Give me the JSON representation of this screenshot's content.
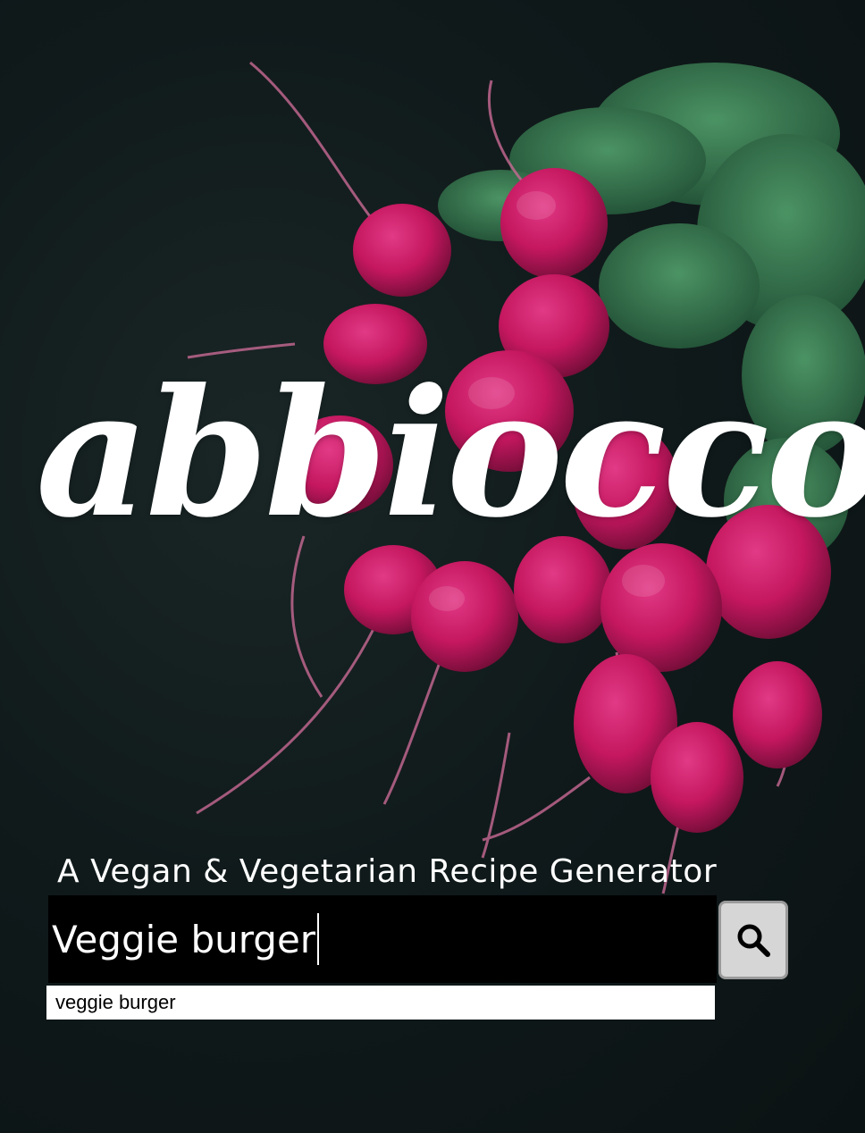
{
  "hero": {
    "logo_text": "abbiocco",
    "tagline": "A Vegan & Vegetarian Recipe Generator"
  },
  "search": {
    "value": "Veggie burger",
    "button_icon": "search-icon"
  },
  "autocomplete": {
    "items": [
      "veggie burger"
    ]
  },
  "colors": {
    "background": "#0f1718",
    "radish": "#c4175f",
    "leaf": "#2f7a4e",
    "text": "#ffffff",
    "search_box": "#000000",
    "button": "#d6d6d6"
  }
}
